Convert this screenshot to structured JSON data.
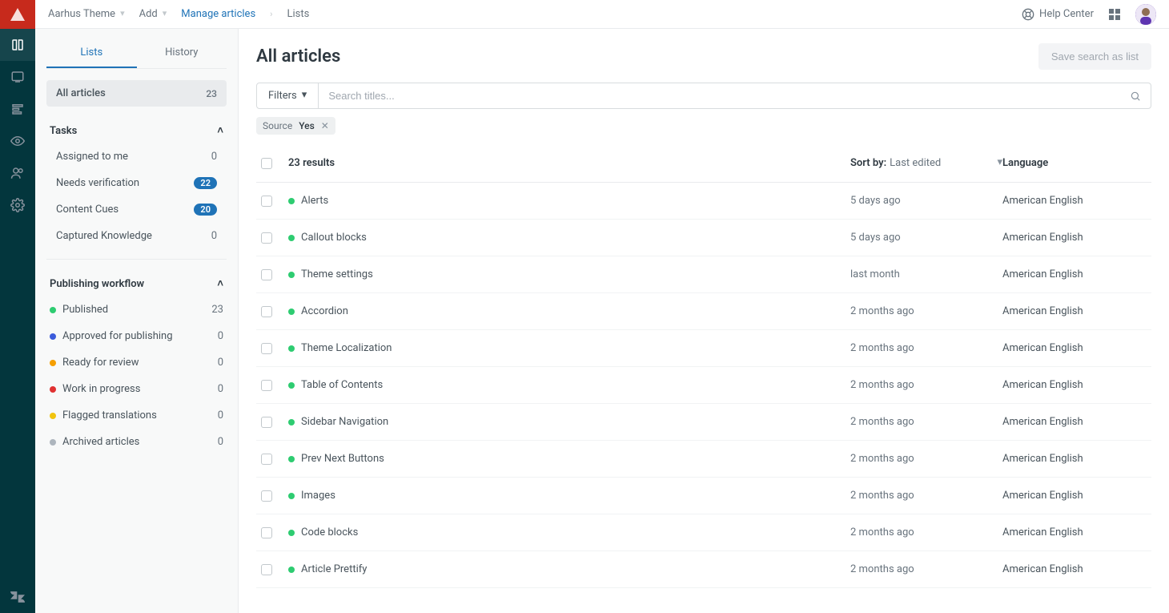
{
  "topbar": {
    "workspace": "Aarhus Theme",
    "add": "Add",
    "breadcrumb_manage": "Manage articles",
    "breadcrumb_current": "Lists",
    "help": "Help Center"
  },
  "sidebar": {
    "tabs": {
      "lists": "Lists",
      "history": "History"
    },
    "all_articles": {
      "label": "All articles",
      "count": "23"
    },
    "tasks_header": "Tasks",
    "tasks": [
      {
        "label": "Assigned to me",
        "count": "0",
        "badge": false
      },
      {
        "label": "Needs verification",
        "count": "22",
        "badge": true
      },
      {
        "label": "Content Cues",
        "count": "20",
        "badge": true
      },
      {
        "label": "Captured Knowledge",
        "count": "0",
        "badge": false
      }
    ],
    "workflow_header": "Publishing workflow",
    "workflow": [
      {
        "label": "Published",
        "count": "23",
        "color": "#2ecc71"
      },
      {
        "label": "Approved for publishing",
        "count": "0",
        "color": "#3b5bdb"
      },
      {
        "label": "Ready for review",
        "count": "0",
        "color": "#f59f00"
      },
      {
        "label": "Work in progress",
        "count": "0",
        "color": "#e03131"
      },
      {
        "label": "Flagged translations",
        "count": "0",
        "color": "#f1c40f"
      },
      {
        "label": "Archived articles",
        "count": "0",
        "color": "#adb5bd"
      }
    ]
  },
  "page": {
    "title": "All articles",
    "save_search": "Save search as list",
    "filters_label": "Filters",
    "search_placeholder": "Search titles...",
    "chip_source_label": "Source",
    "chip_source_value": "Yes"
  },
  "table": {
    "results": "23 results",
    "sort_label": "Sort by:",
    "sort_value": "Last edited",
    "lang_header": "Language",
    "rows": [
      {
        "title": "Alerts",
        "edited": "5 days ago",
        "lang": "American English",
        "dot": "#2ecc71"
      },
      {
        "title": "Callout blocks",
        "edited": "5 days ago",
        "lang": "American English",
        "dot": "#2ecc71"
      },
      {
        "title": "Theme settings",
        "edited": "last month",
        "lang": "American English",
        "dot": "#2ecc71"
      },
      {
        "title": "Accordion",
        "edited": "2 months ago",
        "lang": "American English",
        "dot": "#2ecc71"
      },
      {
        "title": "Theme Localization",
        "edited": "2 months ago",
        "lang": "American English",
        "dot": "#2ecc71"
      },
      {
        "title": "Table of Contents",
        "edited": "2 months ago",
        "lang": "American English",
        "dot": "#2ecc71"
      },
      {
        "title": "Sidebar Navigation",
        "edited": "2 months ago",
        "lang": "American English",
        "dot": "#2ecc71"
      },
      {
        "title": "Prev Next Buttons",
        "edited": "2 months ago",
        "lang": "American English",
        "dot": "#2ecc71"
      },
      {
        "title": "Images",
        "edited": "2 months ago",
        "lang": "American English",
        "dot": "#2ecc71"
      },
      {
        "title": "Code blocks",
        "edited": "2 months ago",
        "lang": "American English",
        "dot": "#2ecc71"
      },
      {
        "title": "Article Prettify",
        "edited": "2 months ago",
        "lang": "American English",
        "dot": "#2ecc71"
      }
    ]
  }
}
